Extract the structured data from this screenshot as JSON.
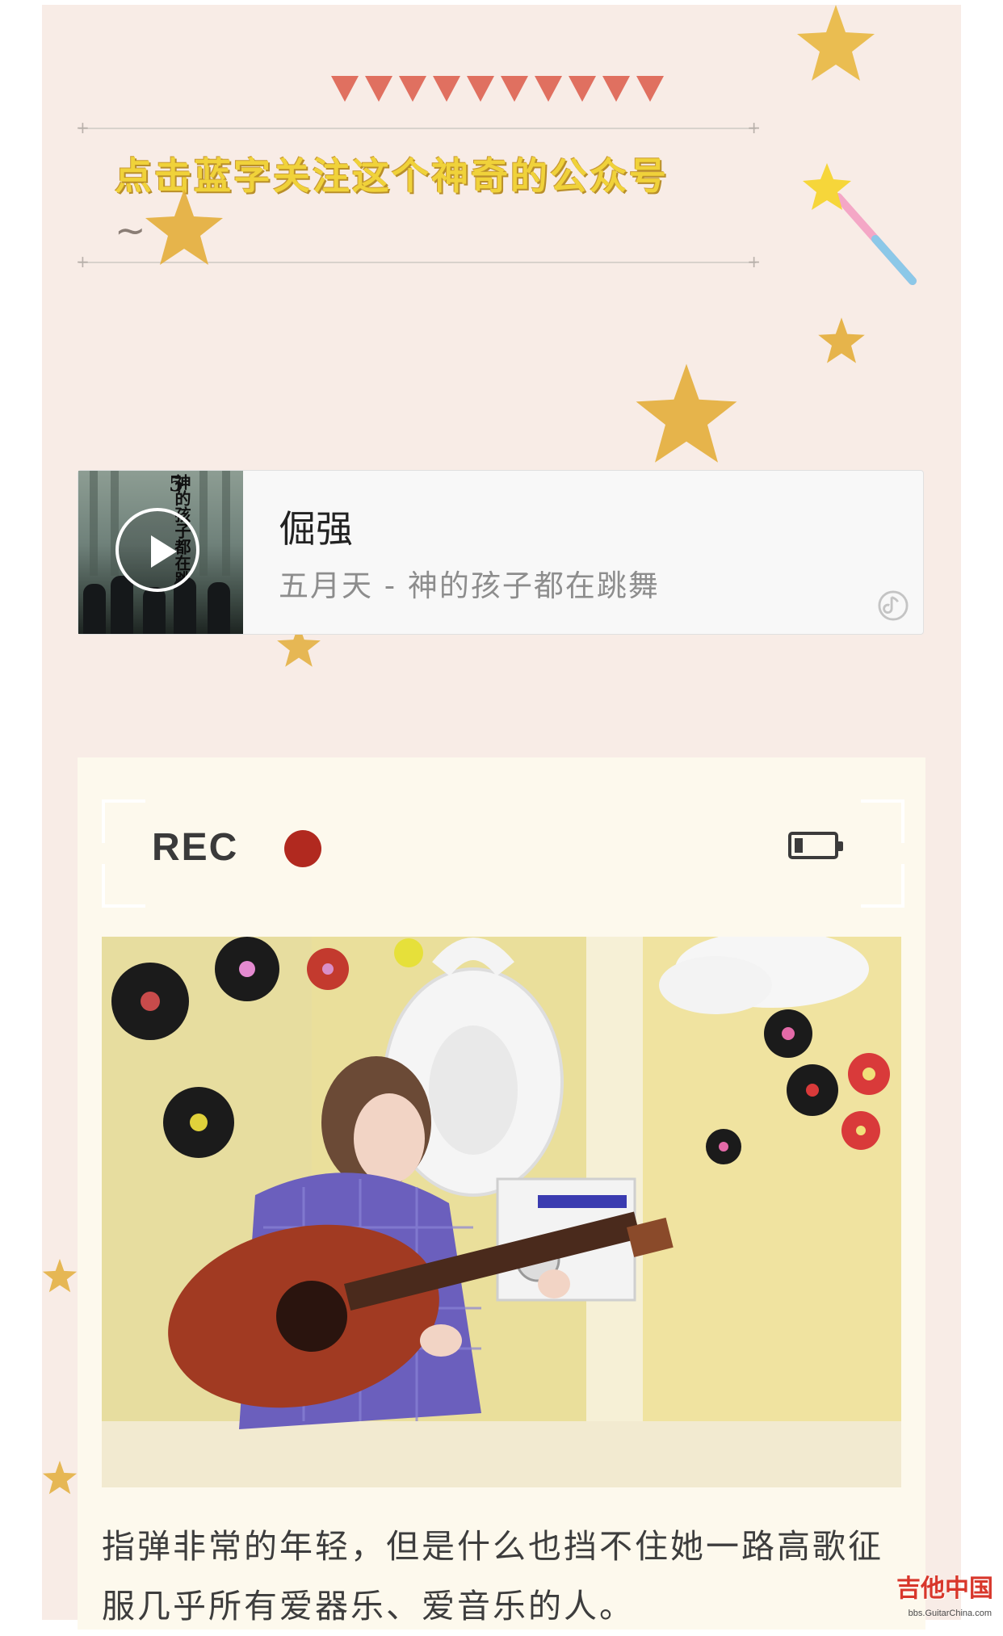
{
  "header": {
    "follow_text": "点击蓝字关注这个神奇的公众号",
    "tilde": "~",
    "accent_color": "#e07060"
  },
  "music_card": {
    "song_title": "倔强",
    "song_meta": "五月天 - 神的孩子都在跳舞",
    "cover_text": "神的孩子都在跳舞",
    "cover_number": "5",
    "play_icon": "play-icon",
    "music_icon": "music-note-icon"
  },
  "rec_panel": {
    "rec_label": "REC",
    "rec_dot_color": "#b1291f",
    "battery_icon": "battery-low-icon",
    "photo_alt": "photo"
  },
  "caption": {
    "line1": "指弹非常的年轻，但是什么也挡不住她一路高歌征",
    "line2": "服几乎所有爱器乐、爱音乐的人。"
  },
  "watermark": {
    "brand": "吉他中国",
    "url": "bbs.GuitarChina.com"
  }
}
